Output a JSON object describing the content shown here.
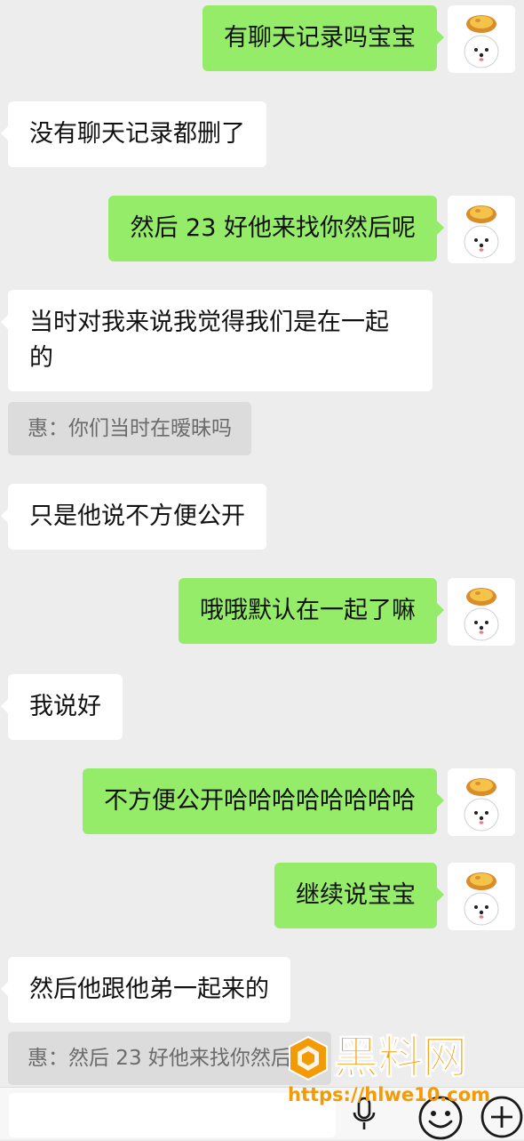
{
  "messages": [
    {
      "side": "out",
      "text": "有聊天记录吗宝宝"
    },
    {
      "side": "in",
      "text": "没有聊天记录都删了"
    },
    {
      "side": "out",
      "text": "然后 23 好他来找你然后呢"
    },
    {
      "side": "in",
      "text": "当时对我来说我觉得我们是在一起的"
    },
    {
      "side": "quote",
      "text": "惠：你们当时在暧昧吗"
    },
    {
      "side": "in",
      "text": "只是他说不方便公开"
    },
    {
      "side": "out",
      "text": "哦哦默认在一起了嘛"
    },
    {
      "side": "in",
      "text": "我说好"
    },
    {
      "side": "out",
      "text": "不方便公开哈哈哈哈哈哈哈哈"
    },
    {
      "side": "out",
      "text": "继续说宝宝"
    },
    {
      "side": "in",
      "text": "然后他跟他弟一起来的"
    },
    {
      "side": "quote",
      "text": "惠：然后 23 好他来找你然后呢"
    }
  ],
  "colors": {
    "background": "#ededed",
    "outgoing_bubble": "#95ec69",
    "incoming_bubble": "#ffffff",
    "quote_bubble": "#dcdcdc",
    "watermark": "#f39a05"
  },
  "avatar_icon": "bichon-dog-with-egg-tart-hat-icon",
  "input_bar": {
    "icons": [
      "microphone-icon",
      "emoji-icon",
      "plus-icon"
    ]
  },
  "watermark": {
    "title": "黑料网",
    "url": "https://hlwe10.com"
  }
}
